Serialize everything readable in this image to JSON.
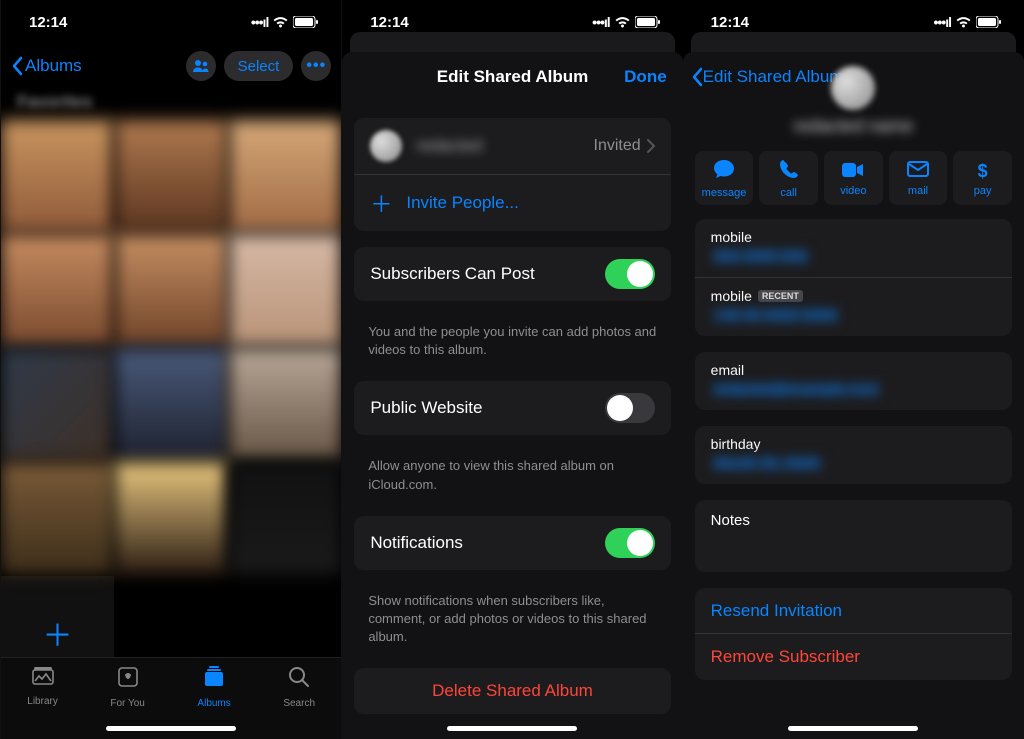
{
  "status": {
    "time": "12:14"
  },
  "screen1": {
    "back_label": "Albums",
    "album_title": "Favorites",
    "select_label": "Select",
    "tabs": {
      "library": "Library",
      "foryou": "For You",
      "albums": "Albums",
      "search": "Search"
    }
  },
  "screen2": {
    "title": "Edit Shared Album",
    "done": "Done",
    "invited_status": "Invited",
    "invite_people": "Invite People...",
    "subscribers_label": "Subscribers Can Post",
    "subscribers_caption": "You and the people you invite can add photos and videos to this album.",
    "public_label": "Public Website",
    "public_caption": "Allow anyone to view this shared album on iCloud.com.",
    "notifications_label": "Notifications",
    "notifications_caption": "Show notifications when subscribers like, comment, or add photos or videos to this shared album.",
    "delete_label": "Delete Shared Album"
  },
  "screen3": {
    "back_label": "Edit Shared Album",
    "actions": {
      "message": "message",
      "call": "call",
      "video": "video",
      "mail": "mail",
      "pay": "pay"
    },
    "fields": {
      "mobile": "mobile",
      "recent_badge": "RECENT",
      "email": "email",
      "birthday": "birthday",
      "notes": "Notes"
    },
    "resend": "Resend Invitation",
    "remove": "Remove Subscriber"
  }
}
